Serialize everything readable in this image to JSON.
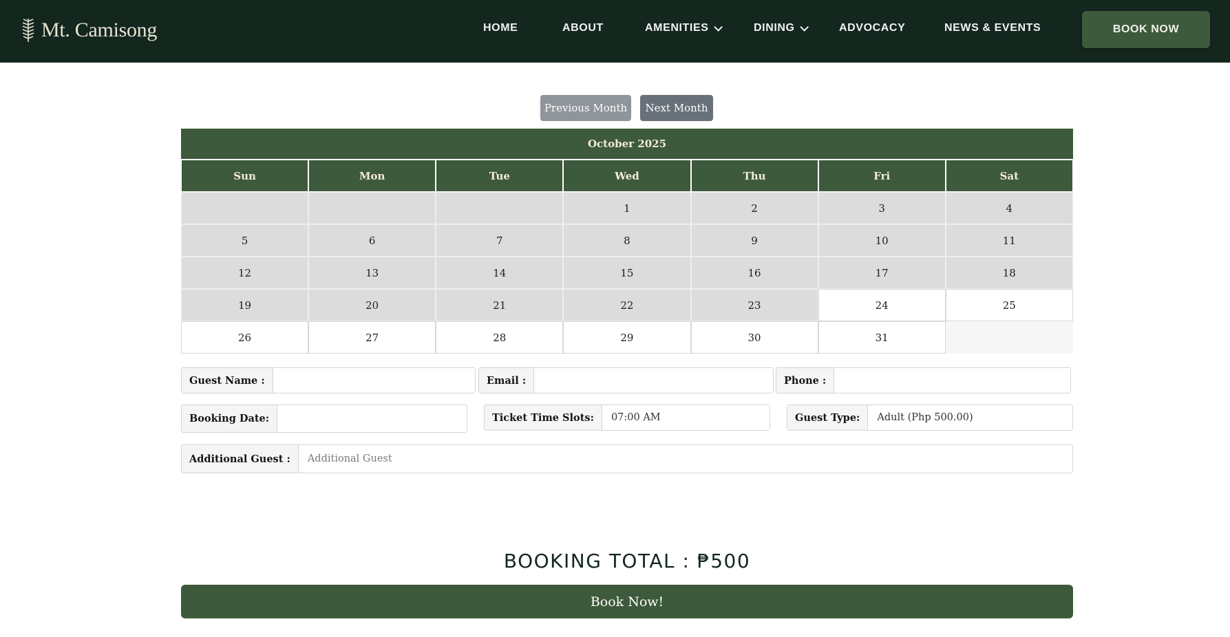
{
  "brand": {
    "name": "Mt. Camisong",
    "logo_icon": "wheat-leaf-icon"
  },
  "nav": {
    "items": [
      {
        "label": "HOME",
        "dropdown": false
      },
      {
        "label": "ABOUT",
        "dropdown": false
      },
      {
        "label": "AMENITIES",
        "dropdown": true
      },
      {
        "label": "DINING",
        "dropdown": true
      },
      {
        "label": "ADVOCACY",
        "dropdown": false
      },
      {
        "label": "NEWS & EVENTS",
        "dropdown": false
      }
    ],
    "cta_label": "BOOK NOW"
  },
  "calendar": {
    "prev_label": "Previous Month",
    "next_label": "Next Month",
    "month_title": "October 2025",
    "weekdays": [
      "Sun",
      "Mon",
      "Tue",
      "Wed",
      "Thu",
      "Fri",
      "Sat"
    ],
    "days": [
      "1",
      "2",
      "3",
      "4",
      "5",
      "6",
      "7",
      "8",
      "9",
      "10",
      "11",
      "12",
      "13",
      "14",
      "15",
      "16",
      "17",
      "18",
      "19",
      "20",
      "21",
      "22",
      "23",
      "24",
      "25",
      "26",
      "27",
      "28",
      "29",
      "30",
      "31"
    ]
  },
  "form": {
    "guest_name_label": "Guest Name :",
    "guest_name_value": "",
    "email_label": "Email :",
    "email_value": "",
    "phone_label": "Phone :",
    "phone_value": "",
    "booking_date_label": "Booking Date:",
    "booking_date_value": "",
    "time_slot_label": "Ticket Time Slots:",
    "time_slot_value": "07:00 AM",
    "guest_type_label": "Guest Type:",
    "guest_type_value": "Adult (Php 500.00)",
    "additional_guest_label": "Additional Guest :",
    "additional_guest_placeholder": "Additional Guest"
  },
  "summary": {
    "total_text": "BOOKING TOTAL : ₱500",
    "submit_label": "Book Now!"
  },
  "colors": {
    "header_bg": "#13271f",
    "accent_green": "#3d5a3c",
    "past_day_bg": "#dcdcdc",
    "available_day_bg": "#ffffff"
  }
}
